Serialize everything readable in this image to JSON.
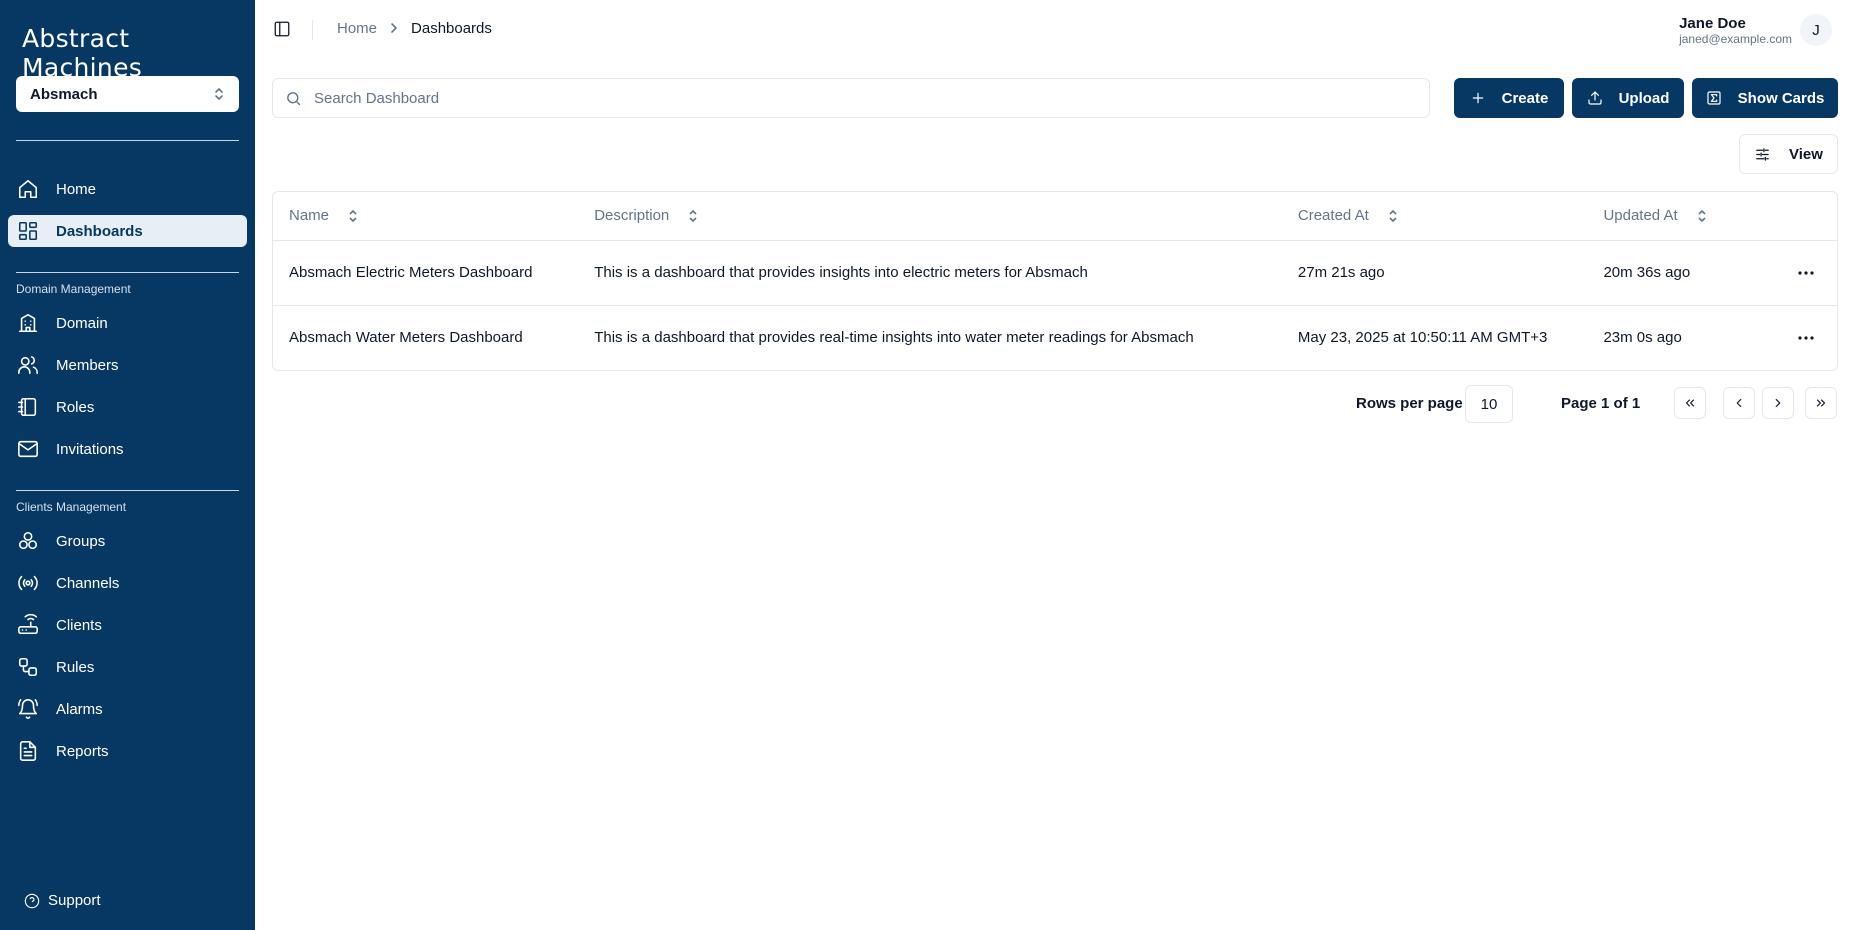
{
  "brand": {
    "logo_text": "Abstract Machines",
    "accent": "#073763"
  },
  "org_selector": {
    "value": "Absmach"
  },
  "sidebar": {
    "top_items": [
      {
        "label": "Home",
        "icon": "home-icon"
      },
      {
        "label": "Dashboards",
        "icon": "dashboard-icon",
        "active": true
      }
    ],
    "domain_section": {
      "title": "Domain Management",
      "items": [
        {
          "label": "Domain",
          "icon": "building-icon"
        },
        {
          "label": "Members",
          "icon": "users-icon"
        },
        {
          "label": "Roles",
          "icon": "notebook-icon"
        },
        {
          "label": "Invitations",
          "icon": "mail-icon"
        }
      ]
    },
    "clients_section": {
      "title": "Clients Management",
      "items": [
        {
          "label": "Groups",
          "icon": "groups-icon"
        },
        {
          "label": "Channels",
          "icon": "radio-icon"
        },
        {
          "label": "Clients",
          "icon": "router-icon"
        },
        {
          "label": "Rules",
          "icon": "workflow-icon"
        },
        {
          "label": "Alarms",
          "icon": "bell-icon"
        },
        {
          "label": "Reports",
          "icon": "file-text-icon"
        }
      ]
    },
    "support_label": "Support"
  },
  "header": {
    "breadcrumb": {
      "home": "Home",
      "current": "Dashboards"
    },
    "user": {
      "name": "Jane Doe",
      "email": "janed@example.com",
      "initial": "J"
    }
  },
  "toolbar": {
    "search_placeholder": "Search Dashboard",
    "create_label": "Create",
    "upload_label": "Upload",
    "show_cards_label": "Show Cards",
    "view_label": "View"
  },
  "table": {
    "columns": [
      "Name",
      "Description",
      "Created At",
      "Updated At"
    ],
    "rows": [
      {
        "name": "Absmach Electric Meters Dashboard",
        "description": "This is a dashboard that provides insights into electric meters for Absmach",
        "created": "27m 21s ago",
        "updated": "20m 36s ago"
      },
      {
        "name": "Absmach Water Meters Dashboard",
        "description": "This is a dashboard that provides real-time insights into water meter readings for Absmach",
        "created": "May 23, 2025 at 10:50:11 AM GMT+3",
        "updated": "23m 0s ago"
      }
    ]
  },
  "pagination": {
    "rows_per_page_label": "Rows per page",
    "rows_per_page_value": "10",
    "page_label": "Page 1 of 1"
  }
}
